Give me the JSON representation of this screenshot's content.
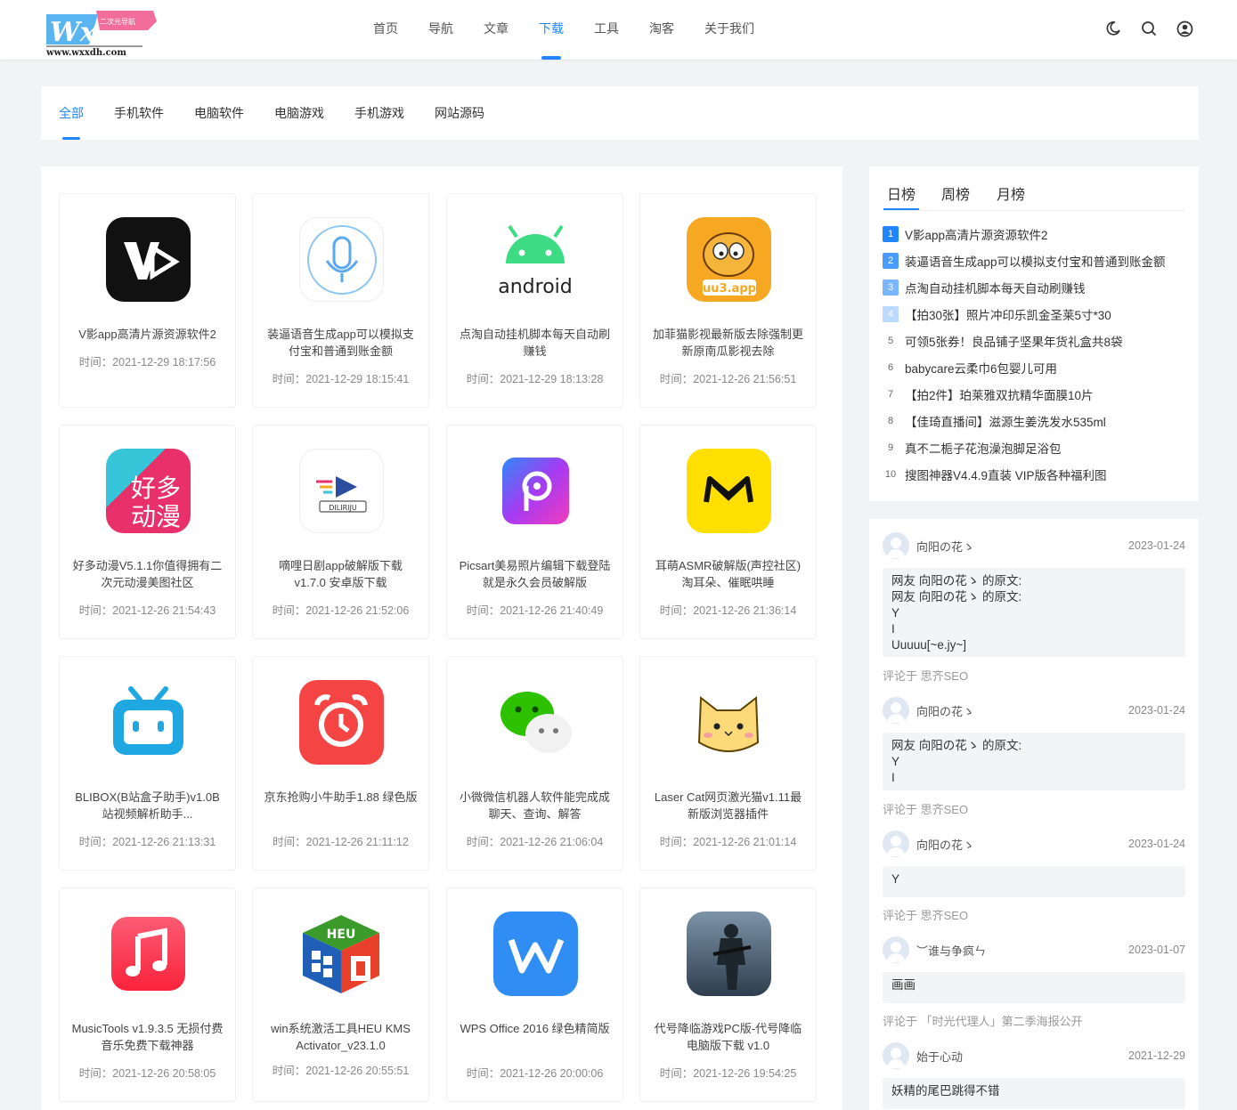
{
  "header": {
    "logo_text": "www.wxxdh.com",
    "logo_badge": "二次元导航",
    "nav": [
      "首页",
      "导航",
      "文章",
      "下载",
      "工具",
      "淘客",
      "关于我们"
    ],
    "active_nav": "下载"
  },
  "categories": [
    "全部",
    "手机软件",
    "电脑软件",
    "电脑游戏",
    "手机游戏",
    "网站源码"
  ],
  "items": [
    {
      "title": "V影app高清片源资源软件2",
      "time": "时间：2021-12-29 18:17:56",
      "icon": "v-film-icon"
    },
    {
      "title": "装逼语音生成app可以模拟支付宝和普通到账金额",
      "time": "时间：2021-12-29 18:15:41",
      "icon": "microphone-icon"
    },
    {
      "title": "点淘自动挂机脚本每天自动刷赚钱",
      "time": "时间：2021-12-29 18:13:28",
      "icon": "android-icon"
    },
    {
      "title": "加菲猫影视最新版去除强制更新原南瓜影视去除",
      "time": "时间：2021-12-26 21:56:51",
      "icon": "garfield-icon"
    },
    {
      "title": "好多动漫V5.1.1你值得拥有二次元动漫美图社区",
      "time": "时间：2021-12-26 21:54:43",
      "icon": "anime-icon"
    },
    {
      "title": "嘀哩日剧app破解版下载v1.7.0 安卓版下载",
      "time": "时间：2021-12-26 21:52:06",
      "icon": "play-icon"
    },
    {
      "title": "Picsart美易照片编辑下载登陆就是永久会员破解版",
      "time": "时间：2021-12-26 21:40:49",
      "icon": "picsart-icon"
    },
    {
      "title": "耳萌ASMR破解版(声控社区)淘耳朵、催眠哄睡",
      "time": "时间：2021-12-26 21:36:14",
      "icon": "asmr-icon"
    },
    {
      "title": "BLIBOX(B站盒子助手)v1.0B站视频解析助手...",
      "time": "时间：2021-12-26 21:13:31",
      "icon": "bilibili-icon"
    },
    {
      "title": "京东抢购小牛助手1.88 绿色版",
      "time": "时间：2021-12-26 21:11:12",
      "icon": "alarm-clock-icon"
    },
    {
      "title": "小微微信机器人软件能完成成聊天、查询、解答",
      "time": "时间：2021-12-26 21:06:04",
      "icon": "wechat-icon"
    },
    {
      "title": "Laser Cat网页激光猫v1.11最新版浏览器插件",
      "time": "时间：2021-12-26 21:01:14",
      "icon": "cat-icon"
    },
    {
      "title": "MusicTools v1.9.3.5 无损付费音乐免费下载神器",
      "time": "时间：2021-12-26 20:58:05",
      "icon": "music-icon"
    },
    {
      "title": "win系统激活工具HEU KMS Activator_v23.1.0",
      "time": "时间：2021-12-26 20:55:51",
      "icon": "heu-kms-icon"
    },
    {
      "title": "WPS Office 2016 绿色精简版",
      "time": "时间：2021-12-26 20:00:06",
      "icon": "wps-icon"
    },
    {
      "title": "代号降临游戏PC版-代号降临电脑版下载 v1.0",
      "time": "时间：2021-12-26 19:54:25",
      "icon": "soldier-icon"
    }
  ],
  "rank": {
    "tabs": [
      "日榜",
      "周榜",
      "月榜"
    ],
    "items": [
      {
        "num": "1",
        "text": "V影app高清片源资源软件2"
      },
      {
        "num": "2",
        "text": "装逼语音生成app可以模拟支付宝和普通到账金额"
      },
      {
        "num": "3",
        "text": "点淘自动挂机脚本每天自动刷赚钱"
      },
      {
        "num": "4",
        "text": "【拍30张】照片冲印乐凯金圣莱5寸*30"
      },
      {
        "num": "5",
        "text": "可领5张券！良品铺子坚果年货礼盒共8袋"
      },
      {
        "num": "6",
        "text": "babycare云柔巾6包婴儿可用"
      },
      {
        "num": "7",
        "text": "【拍2件】珀莱雅双抗精华面膜10片"
      },
      {
        "num": "8",
        "text": "【佳琦直播间】滋源生姜洗发水535ml"
      },
      {
        "num": "9",
        "text": "真不二栀子花泡澡泡脚足浴包"
      },
      {
        "num": "10",
        "text": "搜图神器V4.4.9直装 VIP版各种福利图"
      }
    ]
  },
  "comments": [
    {
      "name": "向阳の花ゝ",
      "date": "2023-01-24",
      "body": "网友 向阳の花ゝ 的原文:\n网友 向阳の花ゝ 的原文:\nY\nI\nUuuuu[~e.jy~]",
      "on": "评论于 思齐SEO"
    },
    {
      "name": "向阳の花ゝ",
      "date": "2023-01-24",
      "body": "网友 向阳の花ゝ 的原文:\nY\nI",
      "on": "评论于 思齐SEO"
    },
    {
      "name": "向阳の花ゝ",
      "date": "2023-01-24",
      "body": "Y",
      "on": "评论于 思齐SEO"
    },
    {
      "name": "︶谁与争疯ㄣ",
      "date": "2023-01-07",
      "body": "画画",
      "on": "评论于 「时光代理人」第二季海报公开"
    },
    {
      "name": "始于心动",
      "date": "2021-12-29",
      "body": "妖精的尾巴跳得不错",
      "on": ""
    }
  ]
}
